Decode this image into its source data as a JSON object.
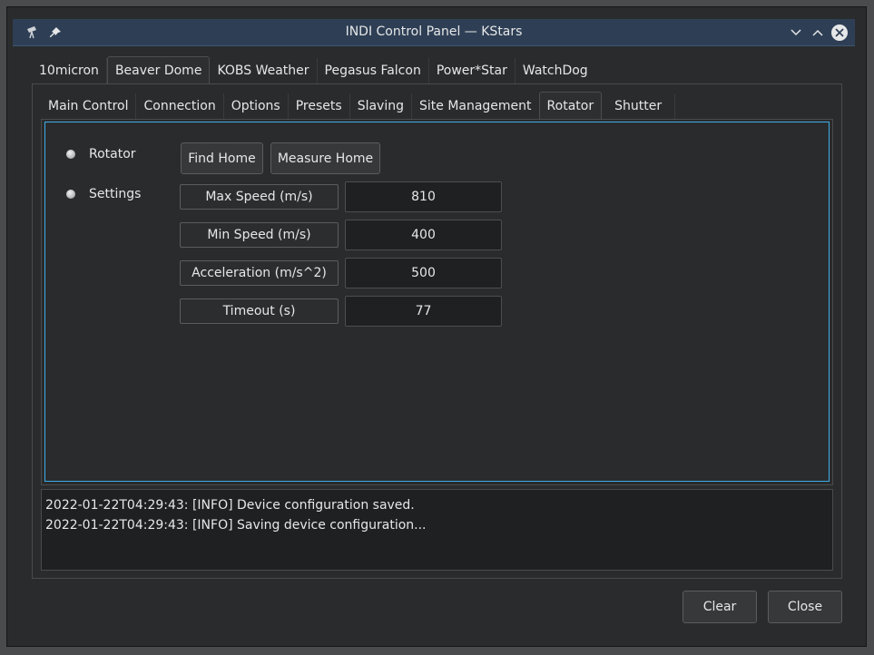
{
  "window": {
    "title": "INDI Control Panel — KStars"
  },
  "devices": [
    "10micron",
    "Beaver Dome",
    "KOBS Weather",
    "Pegasus Falcon",
    "Power*Star",
    "WatchDog"
  ],
  "active_device": "Beaver Dome",
  "groups": [
    "Main Control",
    "Connection",
    "Options",
    "Presets",
    "Slaving",
    "Site Management",
    "Rotator",
    "Shutter"
  ],
  "active_group": "Rotator",
  "rotator": {
    "label": "Rotator",
    "buttons": {
      "find_home": "Find Home",
      "measure_home": "Measure Home"
    }
  },
  "settings": {
    "label": "Settings",
    "rows": [
      {
        "name": "Max Speed (m/s)",
        "value": "810"
      },
      {
        "name": "Min Speed (m/s)",
        "value": "400"
      },
      {
        "name": "Acceleration (m/s^2)",
        "value": "500"
      },
      {
        "name": "Timeout (s)",
        "value": "77"
      }
    ]
  },
  "log": [
    "2022-01-22T04:29:43: [INFO] Device configuration saved.",
    "2022-01-22T04:29:43: [INFO] Saving device configuration..."
  ],
  "buttons": {
    "clear": "Clear",
    "close": "Close"
  }
}
